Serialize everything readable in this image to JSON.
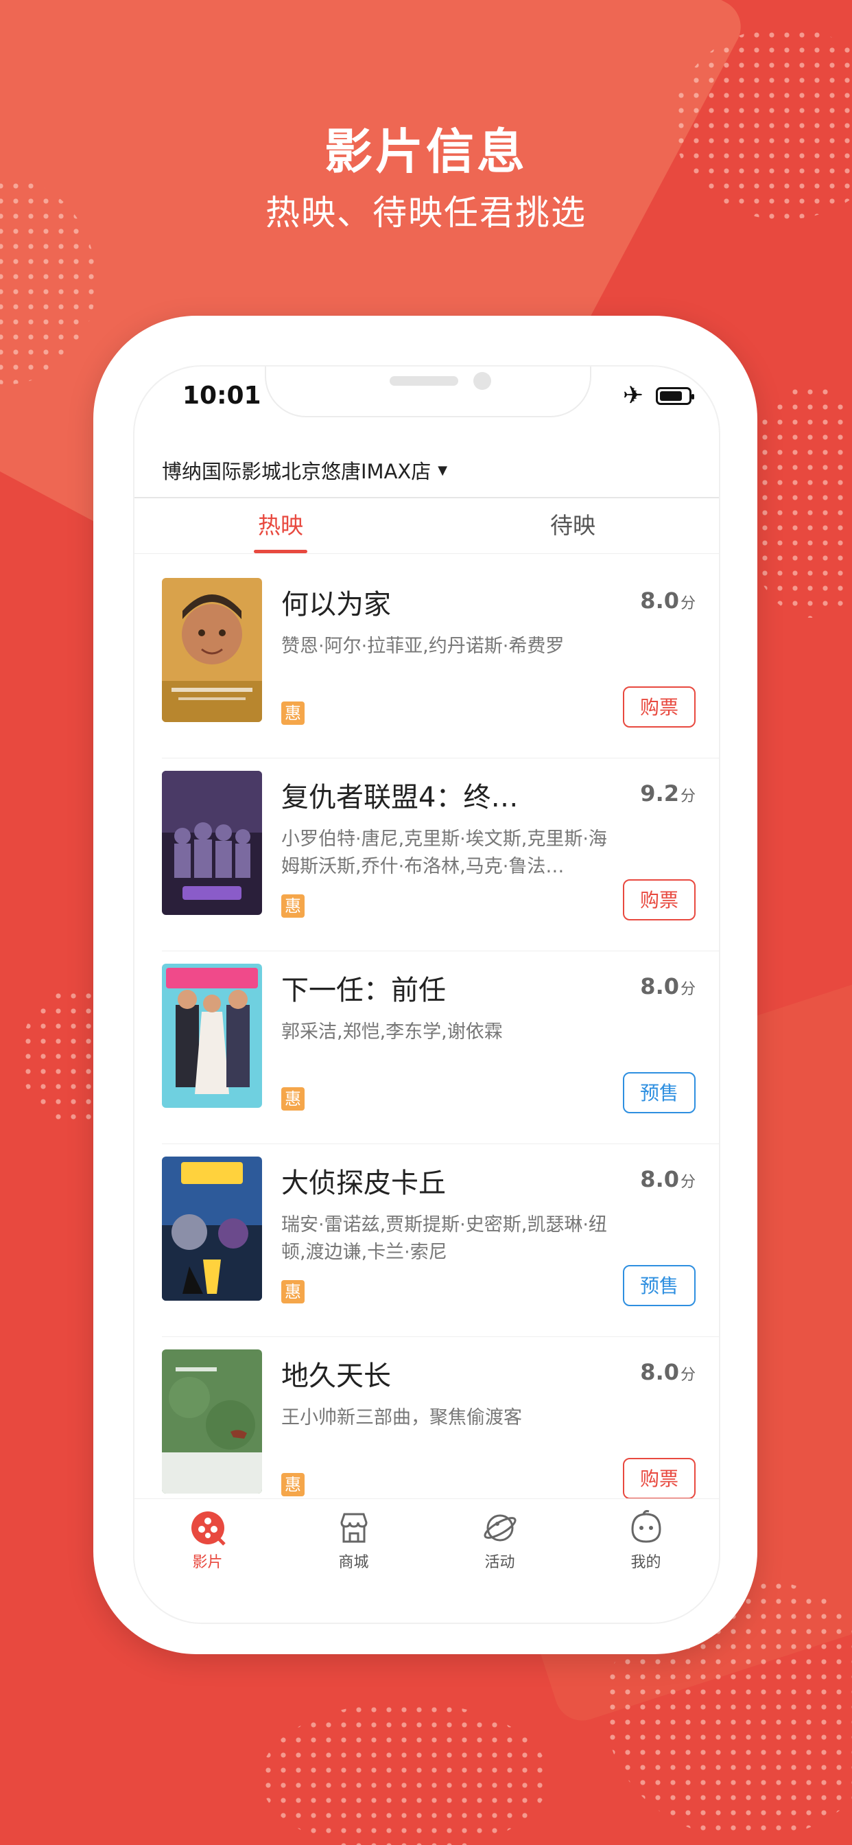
{
  "promo": {
    "headline": "影片信息",
    "subline": "热映、待映任君挑选"
  },
  "status_bar": {
    "time": "10:01",
    "airplane_mode": true,
    "battery_level": 0.8
  },
  "cinema_name": "博纳国际影城北京悠唐IMAX店",
  "tabs": [
    {
      "label": "热映",
      "active": true
    },
    {
      "label": "待映",
      "active": false
    }
  ],
  "movies": [
    {
      "title": "何以为家",
      "score": "8.0",
      "score_unit": "分",
      "cast": "赞恩·阿尔·拉菲亚,约丹诺斯·希费罗",
      "badge": "惠",
      "action": "购票",
      "action_color": "#e8493f"
    },
    {
      "title": "复仇者联盟4：终…",
      "score": "9.2",
      "score_unit": "分",
      "cast": "小罗伯特·唐尼,克里斯·埃文斯,克里斯·海姆斯沃斯,乔什·布洛林,马克·鲁法…",
      "badge": "惠",
      "action": "购票",
      "action_color": "#e8493f"
    },
    {
      "title": "下一任：前任",
      "score": "8.0",
      "score_unit": "分",
      "cast": "郭采洁,郑恺,李东学,谢依霖",
      "badge": "惠",
      "action": "预售",
      "action_color": "#2e8fe0"
    },
    {
      "title": "大侦探皮卡丘",
      "score": "8.0",
      "score_unit": "分",
      "cast": "瑞安·雷诺兹,贾斯提斯·史密斯,凯瑟琳·纽顿,渡边谦,卡兰·索尼",
      "badge": "惠",
      "action": "预售",
      "action_color": "#2e8fe0"
    },
    {
      "title": "地久天长",
      "score": "8.0",
      "score_unit": "分",
      "cast": "王小帅新三部曲，聚焦偷渡客",
      "badge": "惠",
      "action": "购票",
      "action_color": "#e8493f"
    }
  ],
  "tabbar": [
    {
      "label": "影片",
      "icon": "film-reel-icon",
      "active": true
    },
    {
      "label": "商城",
      "icon": "store-icon",
      "active": false
    },
    {
      "label": "活动",
      "icon": "planet-icon",
      "active": false
    },
    {
      "label": "我的",
      "icon": "profile-face-icon",
      "active": false
    }
  ],
  "colors": {
    "brand": "#e8493f",
    "presale_blue": "#2e8fe0",
    "badge_orange": "#f5a64a"
  }
}
